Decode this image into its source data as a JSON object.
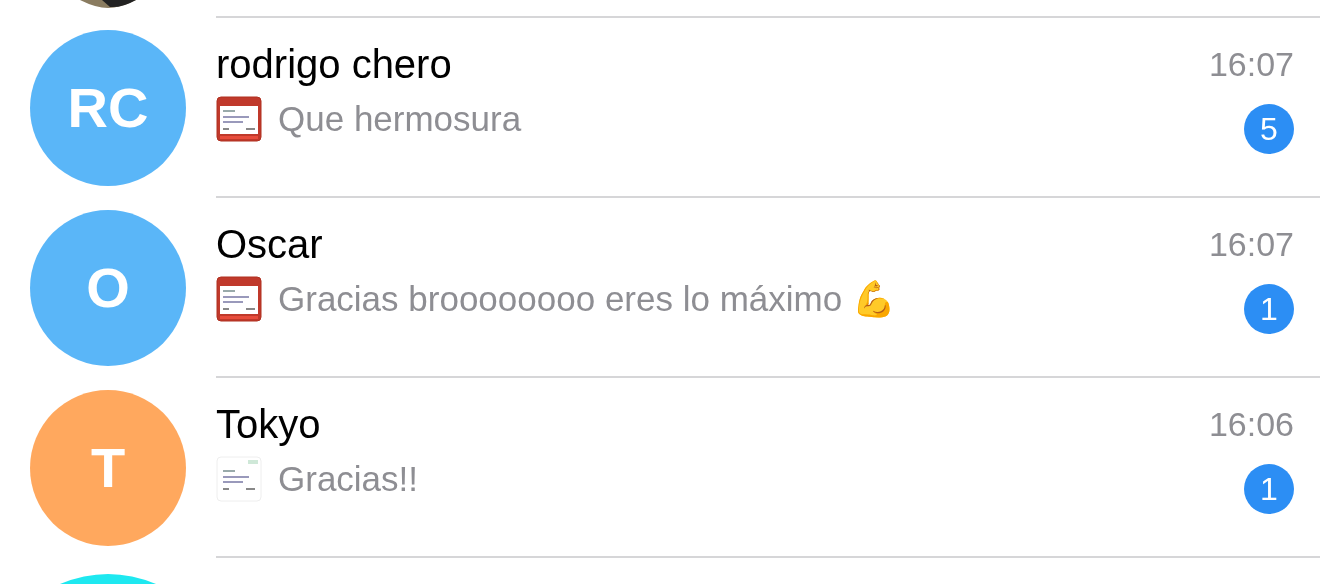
{
  "chats": [
    {
      "initials": "RC",
      "color": "#5ab6f8",
      "name": "rodrigo chero",
      "thumbnail": {
        "kind": "red"
      },
      "preview": "Que hermosura",
      "time": "16:07",
      "unread": "5"
    },
    {
      "initials": "O",
      "color": "#5ab6f8",
      "name": "Oscar",
      "thumbnail": {
        "kind": "red"
      },
      "preview": "Gracias broooooooo eres lo máximo 💪",
      "time": "16:07",
      "unread": "1"
    },
    {
      "initials": "T",
      "color": "#ffa85e",
      "name": "Tokyo",
      "thumbnail": {
        "kind": "white"
      },
      "preview": "Gracias!!",
      "time": "16:06",
      "unread": "1"
    }
  ]
}
